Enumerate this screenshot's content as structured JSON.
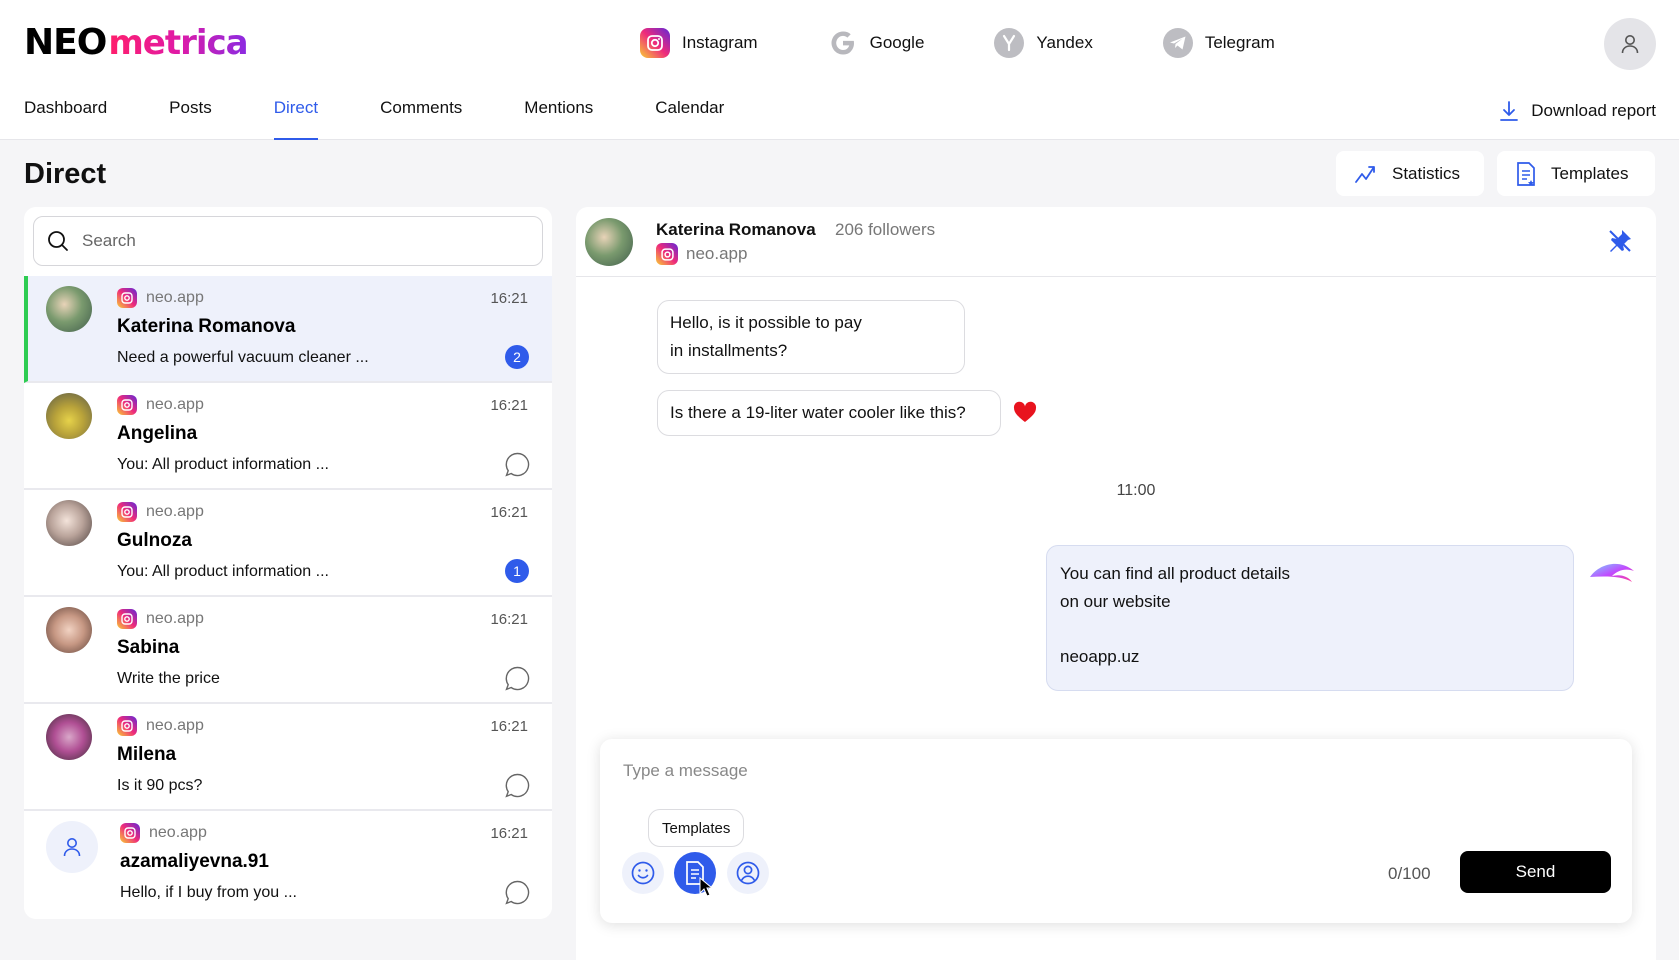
{
  "logo": {
    "part1": "NEO",
    "part2": "metrica"
  },
  "platforms": [
    {
      "label": "Instagram",
      "icon": "instagram-icon"
    },
    {
      "label": "Google",
      "icon": "google-icon"
    },
    {
      "label": "Yandex",
      "icon": "yandex-icon"
    },
    {
      "label": "Telegram",
      "icon": "telegram-icon"
    }
  ],
  "nav": {
    "tabs": [
      {
        "label": "Dashboard"
      },
      {
        "label": "Posts"
      },
      {
        "label": "Direct",
        "active": true
      },
      {
        "label": "Comments"
      },
      {
        "label": "Mentions"
      },
      {
        "label": "Calendar"
      }
    ],
    "download_label": "Download report"
  },
  "page": {
    "title": "Direct",
    "statistics_label": "Statistics",
    "templates_label": "Templates"
  },
  "search": {
    "placeholder": "Search"
  },
  "chats": [
    {
      "source": "neo.app",
      "time": "16:21",
      "name": "Katerina Romanova",
      "preview": "Need a powerful vacuum cleaner ...",
      "unread": "2",
      "active": true
    },
    {
      "source": "neo.app",
      "time": "16:21",
      "name": "Angelina",
      "preview": "You: All product information ...",
      "unread": ""
    },
    {
      "source": "neo.app",
      "time": "16:21",
      "name": "Gulnoza",
      "preview": "You: All product information ...",
      "unread": "1"
    },
    {
      "source": "neo.app",
      "time": "16:21",
      "name": "Sabina",
      "preview": "Write the price",
      "unread": ""
    },
    {
      "source": "neo.app",
      "time": "16:21",
      "name": "Milena",
      "preview": "Is it 90 pcs?",
      "unread": ""
    },
    {
      "source": "neo.app",
      "time": "16:21",
      "name": "azamaliyevna.91",
      "preview": "Hello, if I buy from you ...",
      "unread": ""
    }
  ],
  "conversation": {
    "name": "Katerina Romanova",
    "followers": "206 followers",
    "source": "neo.app",
    "messages_in": [
      {
        "lines": [
          "Hello, is it possible to pay",
          "in installments?"
        ]
      },
      {
        "lines": [
          "Is there a 19-liter water cooler like this?"
        ]
      }
    ],
    "time_divider": "11:00",
    "message_out": {
      "lines": [
        "You can find all product details",
        "on our website"
      ],
      "link": "neoapp.uz"
    }
  },
  "composer": {
    "placeholder": "Type a message",
    "tooltip": "Templates",
    "counter": "0/100",
    "send_label": "Send"
  },
  "colors": {
    "accent": "#2f5bea",
    "active_bar": "#2ecc52",
    "heart": "#e8131e"
  }
}
